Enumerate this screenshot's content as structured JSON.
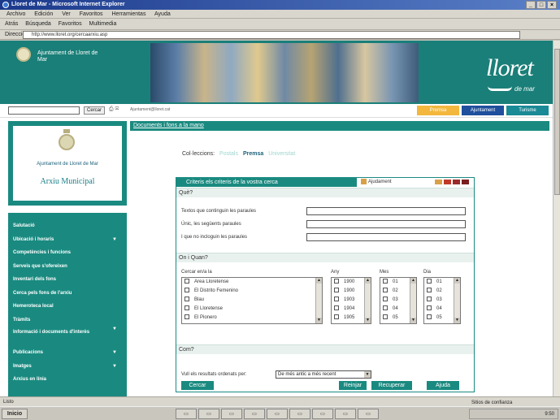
{
  "window": {
    "title": "Lloret de Mar - Microsoft Internet Explorer",
    "controls": [
      "_",
      "□",
      "×"
    ]
  },
  "menu": [
    "Archivo",
    "Edición",
    "Ver",
    "Favoritos",
    "Herramientas",
    "Ayuda"
  ],
  "toolbar": [
    "Atrás",
    "Búsqueda",
    "Favoritos",
    "Multimedia"
  ],
  "address": {
    "label": "Dirección",
    "url": "http://www.lloret.org/cercaarxiu.asp"
  },
  "banner": {
    "institution": "Ajuntament de Lloret de Mar",
    "brand": "lloret",
    "brand_sub": "de mar"
  },
  "search": {
    "button": "Cercar",
    "url": "Ajuntament@lloret.cat"
  },
  "top_tabs": [
    "Premsa",
    "Ajuntament",
    "Turisme"
  ],
  "sidebar": {
    "institution": "Ajuntament de Lloret de Mar",
    "archive": "Arxiu Municipal",
    "nav": [
      {
        "label": "Salutació",
        "arrow": ""
      },
      {
        "label": "Ubicació i horaris",
        "arrow": "▼"
      },
      {
        "label": "Competències i funcions",
        "arrow": ""
      },
      {
        "label": "Serveis que s'ofereixen",
        "arrow": ""
      },
      {
        "label": "Inventari dels fons",
        "arrow": ""
      },
      {
        "label": "Cerca pels fons de l'arxiu",
        "arrow": ""
      },
      {
        "label": "Hemeroteca local",
        "arrow": ""
      },
      {
        "label": "Tràmits",
        "arrow": ""
      },
      {
        "label": "Informació i documents d'interès",
        "arrow": "▼"
      },
      {
        "label": "Publicacions",
        "arrow": "▼"
      },
      {
        "label": "Imatges",
        "arrow": "▼"
      },
      {
        "label": "Arxius en línia",
        "arrow": ""
      }
    ]
  },
  "content": {
    "breadcrumb": "Documents i fons a la mano",
    "collections_label": "Col·leccions:",
    "collections": [
      "Postals",
      "Premsa",
      "Universitat"
    ],
    "panel_title": "Criteris els criteris de la vostra cerca",
    "help": "Ajudament",
    "flag_colors": [
      "#d9a04a",
      "#c0392b",
      "#9b2a2a",
      "#7a1e1e"
    ],
    "section_what": "Què?",
    "what_rows": [
      "Textos que continguin les paraules",
      "Únic, les següents paraules",
      "I que no incloguin les paraules"
    ],
    "section_where": "On i Quan?",
    "where_label": "Cercar en/a la",
    "places": [
      "Area Lloretense",
      "El Distrito Femenino",
      "Blau",
      "El Lloretense",
      "El Pionero"
    ],
    "year_label": "Any",
    "years": [
      "1900",
      "1900",
      "1903",
      "1904",
      "1905"
    ],
    "month_label": "Mes",
    "months": [
      "01",
      "02",
      "03",
      "04",
      "05"
    ],
    "day_label": "Dia",
    "days": [
      "01",
      "02",
      "03",
      "04",
      "05"
    ],
    "section_how": "Com?",
    "order_label": "Vull els resultats ordenats per:",
    "order_value": "De més antic a més recent",
    "buttons": {
      "cancel": "Cercar",
      "reset": "Reinjar",
      "recover": "Recuperar",
      "help": "Ajuda"
    }
  },
  "status": {
    "left": "Listo",
    "zone": "Sitios de confianza"
  },
  "taskbar": {
    "start": "Inicio",
    "clock": "9:50"
  }
}
